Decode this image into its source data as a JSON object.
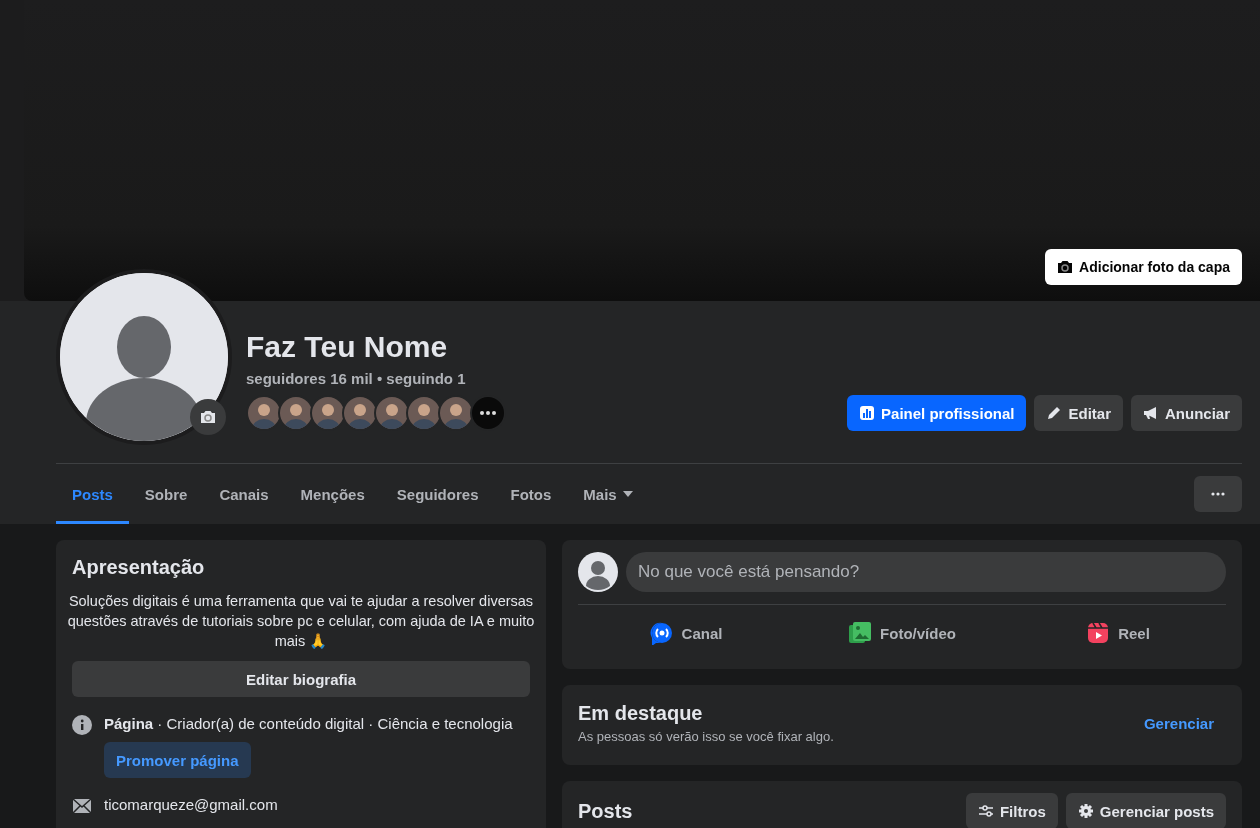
{
  "cover": {
    "button": "Adicionar foto da capa"
  },
  "profile": {
    "name": "Faz Teu Nome",
    "stats": "seguidores 16 mil • seguindo 1",
    "followers": [
      {
        "kind": "photo"
      },
      {
        "kind": "photo"
      },
      {
        "kind": "photo"
      },
      {
        "kind": "photo"
      },
      {
        "kind": "photo"
      },
      {
        "kind": "photo"
      },
      {
        "kind": "photo"
      },
      {
        "kind": "more"
      }
    ],
    "actions": [
      {
        "label": "Painel profissional",
        "kind": "primary"
      },
      {
        "label": "Editar",
        "kind": "secondary"
      },
      {
        "label": "Anunciar",
        "kind": "secondary"
      }
    ]
  },
  "tabs": [
    {
      "label": "Posts",
      "selected": true,
      "has_menu": false
    },
    {
      "label": "Sobre",
      "selected": false,
      "has_menu": false
    },
    {
      "label": "Canais",
      "selected": false,
      "has_menu": false
    },
    {
      "label": "Menções",
      "selected": false,
      "has_menu": false
    },
    {
      "label": "Seguidores",
      "selected": false,
      "has_menu": false
    },
    {
      "label": "Fotos",
      "selected": false,
      "has_menu": false
    },
    {
      "label": "Mais",
      "selected": false,
      "has_menu": true
    }
  ],
  "intro": {
    "title": "Apresentação",
    "bio": "Soluções digitais é uma ferramenta que vai te ajudar a resolver diversas questões através de tutoriais sobre pc e celular, com ajuda de IA e muito mais 🙏",
    "edit_button": "Editar biografia",
    "details": [
      {
        "kind": "info",
        "text": "**Página** · Criador(a) de conteúdo digital · Ciência e tecnologia",
        "button": "Promover página"
      },
      {
        "kind": "email",
        "text": "ticomarqueze@gmail.com"
      }
    ]
  },
  "composer": {
    "placeholder": "No que você está pensando?",
    "actions": [
      {
        "label": "Canal"
      },
      {
        "label": "Foto/vídeo"
      },
      {
        "label": "Reel"
      }
    ]
  },
  "featured": {
    "title": "Em destaque",
    "subtitle": "As pessoas só verão isso se você fixar algo.",
    "link": "Gerenciar"
  },
  "posts": {
    "title": "Posts",
    "buttons": [
      {
        "label": "Filtros"
      },
      {
        "label": "Gerenciar posts"
      }
    ]
  }
}
